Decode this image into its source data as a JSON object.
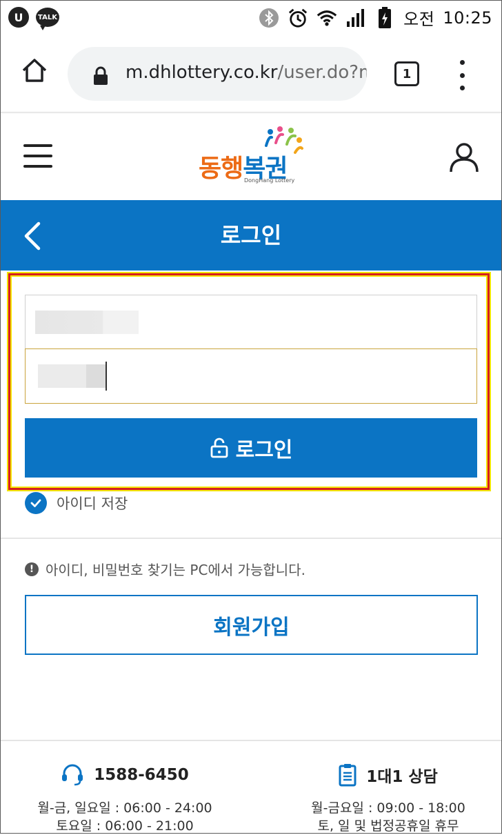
{
  "status_bar": {
    "u_badge": "U",
    "talk_badge": "TALK",
    "ampm": "오전",
    "time": "10:25",
    "icons": [
      "u-plus-icon",
      "kakaotalk-icon",
      "bluetooth-icon",
      "alarm-icon",
      "wifi-icon",
      "signal-icon",
      "battery-charging-icon"
    ]
  },
  "browser": {
    "url_host": "m.dhlottery.co.kr",
    "url_path": "/user.do?m",
    "tab_count": "1"
  },
  "site_header": {
    "logo_text_orange": "동행",
    "logo_text_blue": "복권",
    "logo_subtitle": "DongHang Lottery"
  },
  "page_title": "로그인",
  "login_form": {
    "login_button_label": "로그인",
    "save_id_label": "아이디 저장"
  },
  "notice_text": "아이디, 비밀번호 찾기는 PC에서 가능합니다.",
  "join_button_label": "회원가입",
  "contacts": {
    "phone": {
      "title": "1588-6450",
      "line1": "월-금, 일요일 : 06:00 - 24:00",
      "line2": "토요일 : 06:00 - 21:00"
    },
    "chat": {
      "title": "1대1 상담",
      "line1": "월-금요일 : 09:00 - 18:00",
      "line2": "토, 일 및 법정공휴일 휴무"
    }
  },
  "colors": {
    "brand_blue": "#0b74c4",
    "brand_orange": "#ec6b16",
    "highlight_red": "#d61e1e",
    "highlight_yellow": "#f3e400"
  }
}
